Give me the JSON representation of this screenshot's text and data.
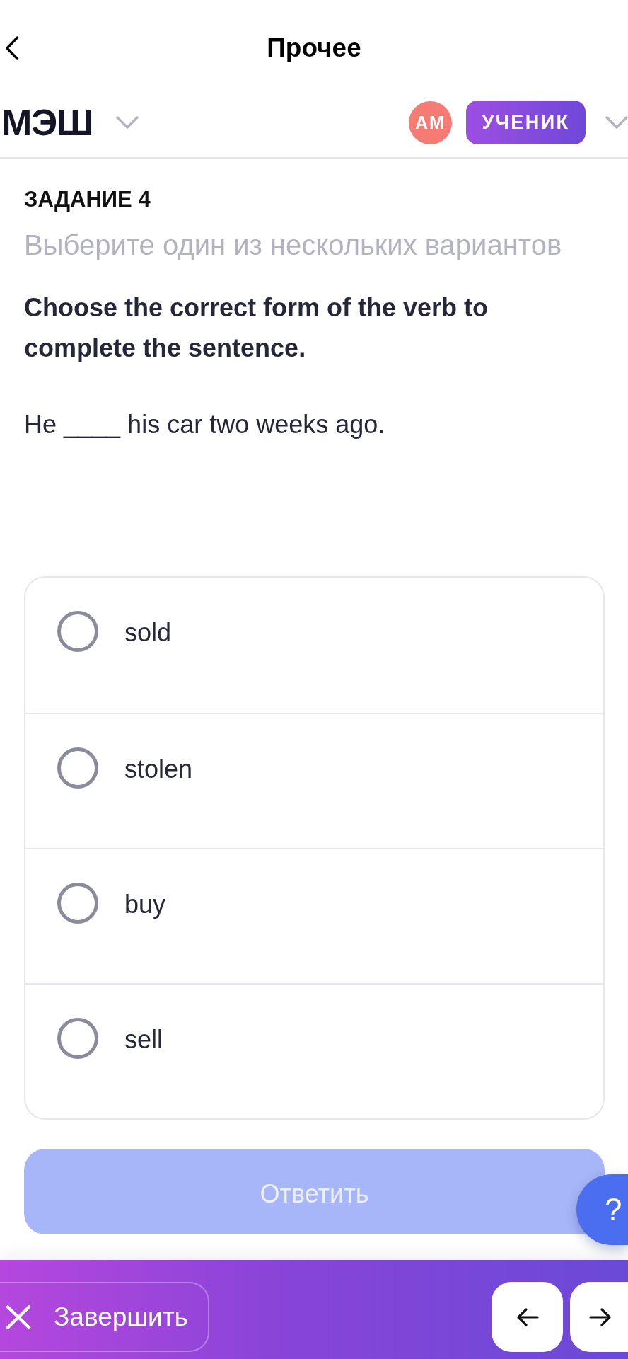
{
  "nav_bar": {
    "title": "Прочее"
  },
  "header": {
    "logo": "МЭШ",
    "avatar_initials": "АМ",
    "role": "УЧЕНИК"
  },
  "task": {
    "number_label": "ЗАДАНИЕ 4",
    "instruction": "Выберите один из нескольких вариантов",
    "question": "Choose the correct form of the verb to complete the sentence.",
    "sentence": "He ____ his car two weeks ago."
  },
  "options": [
    {
      "label": "sold",
      "selected": false
    },
    {
      "label": "stolen",
      "selected": false
    },
    {
      "label": "buy",
      "selected": false
    },
    {
      "label": "sell",
      "selected": false
    }
  ],
  "answer_button": {
    "label": "Ответить",
    "disabled": true
  },
  "help_button": {
    "label": "?"
  },
  "bottom_bar": {
    "finish_button": {
      "label": "Завершить"
    }
  }
}
